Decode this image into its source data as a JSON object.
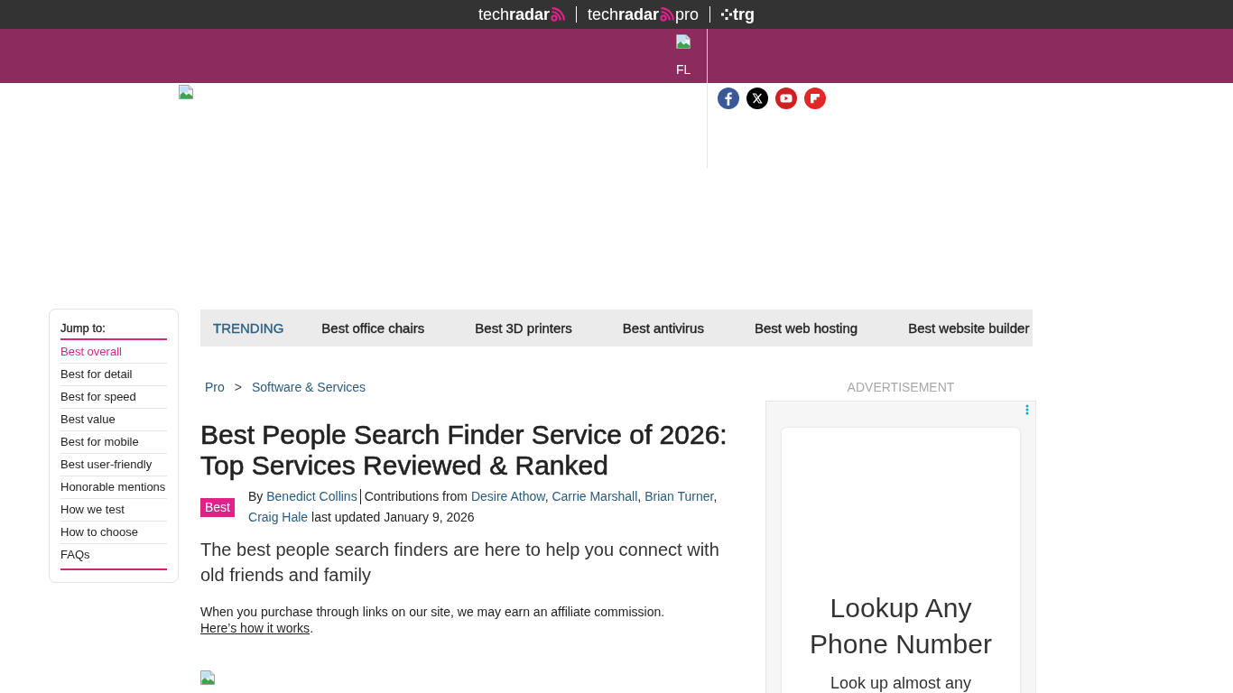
{
  "network_bar": {
    "brands": [
      {
        "kind": "radar",
        "name": "tech**radar**"
      },
      {
        "kind": "radar",
        "name": "tech**radar**",
        "suffix": "pro"
      },
      {
        "kind": "dots",
        "name": "trg"
      }
    ]
  },
  "header": {
    "nav_image": {
      "alt": "FL"
    },
    "social_links": [
      {
        "kind": "facebook"
      },
      {
        "kind": "x"
      },
      {
        "kind": "youtube"
      },
      {
        "kind": "flipboard"
      }
    ]
  },
  "jump_to": {
    "title": "Jump to:",
    "items": [
      {
        "label": "Best overall",
        "selected": true
      },
      {
        "label": "Best for detail",
        "selected": false
      },
      {
        "label": "Best for speed",
        "selected": false
      },
      {
        "label": "Best value",
        "selected": false
      },
      {
        "label": "Best for mobile",
        "selected": false
      },
      {
        "label": "Best user-friendly",
        "selected": false
      },
      {
        "label": "Honorable mentions",
        "selected": false
      },
      {
        "label": "How we test",
        "selected": false
      },
      {
        "label": "How to choose",
        "selected": false
      },
      {
        "label": "FAQs",
        "selected": false
      }
    ]
  },
  "trending": {
    "label": "TRENDING",
    "items": [
      "Best office chairs",
      "Best 3D printers",
      "Best antivirus",
      "Best web hosting",
      "Best website builder"
    ]
  },
  "breadcrumb": {
    "items": [
      "Pro",
      "Software & Services"
    ],
    "separator": ">"
  },
  "article": {
    "title": "Best People Search Finder Service of 2026: Top Services Reviewed & Ranked",
    "badge": "Best",
    "byline": {
      "prefix": "By",
      "author": "Benedict Collins",
      "contributions_label": "Contributions from",
      "contributors": [
        {
          "name": "Desire Athow",
          "separator": ","
        },
        {
          "name": "Carrie Marshall",
          "separator": ","
        },
        {
          "name": "Brian Turner",
          "separator": ","
        },
        {
          "name": "Craig Hale"
        }
      ],
      "updated": "last updated January 9, 2026"
    },
    "strapline": "The best people search finders are here to help you connect with old friends and family",
    "disclosure": {
      "text": "When you purchase through links on our site, we may earn an affiliate commission.",
      "link": "Here’s how it works",
      "end": "."
    }
  },
  "advertisement": {
    "label": "ADVERTISEMENT",
    "headline": "Lookup Any Phone Number",
    "body": "Look up almost any"
  }
}
